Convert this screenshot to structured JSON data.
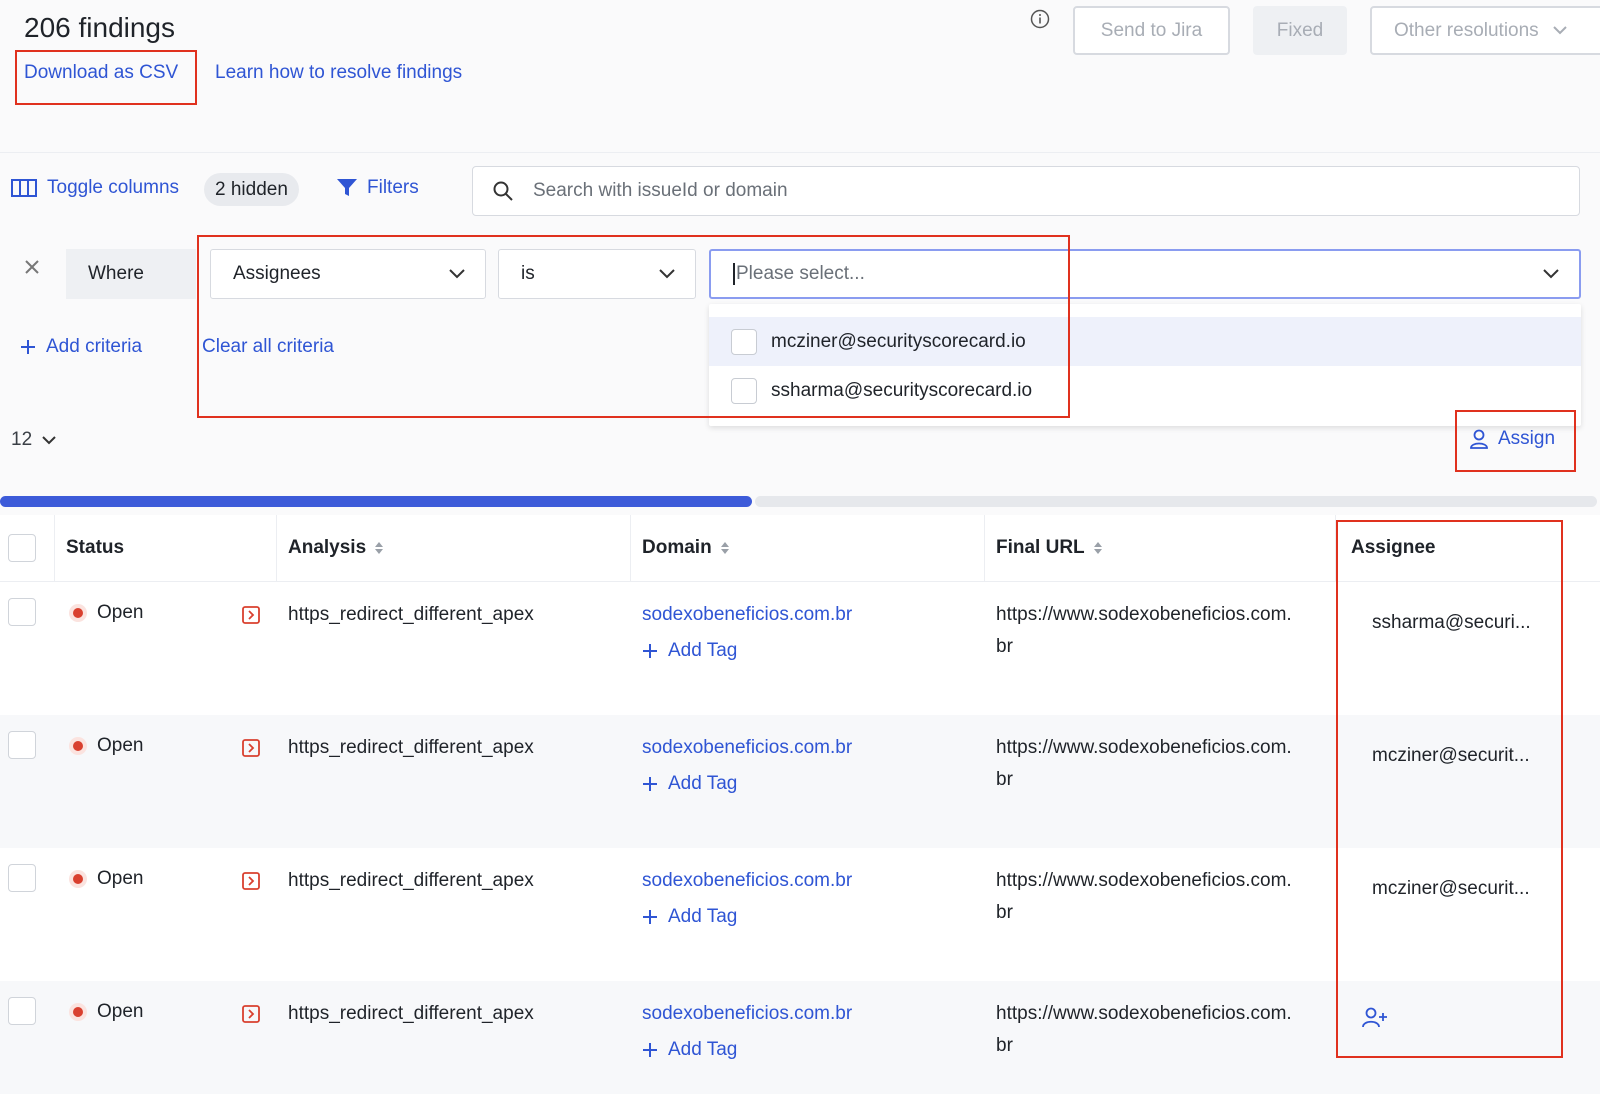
{
  "header": {
    "title": "206 findings",
    "download_csv": "Download as CSV",
    "learn_link": "Learn how to resolve findings",
    "send_to_jira": "Send to Jira",
    "fixed": "Fixed",
    "other_resolutions": "Other resolutions"
  },
  "toolbar": {
    "toggle_columns": "Toggle columns",
    "hidden_count": "2 hidden",
    "filters": "Filters",
    "search_placeholder": "Search with issueId or domain"
  },
  "filter": {
    "where": "Where",
    "field": "Assignees",
    "operator": "is",
    "value_placeholder": "Please select...",
    "add_criteria": "Add criteria",
    "clear_all": "Clear all criteria",
    "options": [
      "mcziner@securityscorecard.io",
      "ssharma@securityscorecard.io"
    ]
  },
  "pagination": {
    "per_page": "12"
  },
  "assign_label": "Assign",
  "scroll_progress": 0.47,
  "colors": {
    "accent": "#2f55d4",
    "danger": "#d9402f",
    "annotation": "#e0311e"
  },
  "table": {
    "headers": {
      "status": "Status",
      "analysis": "Analysis",
      "domain": "Domain",
      "final_url": "Final URL",
      "assignee": "Assignee"
    },
    "add_tag": "Add Tag",
    "rows": [
      {
        "status": "Open",
        "analysis": "https_redirect_different_apex",
        "domain": "sodexobeneficios.com.br",
        "url_line1": "https://www.sodexobeneficios.com.",
        "url_line2": "br",
        "assignee": "ssharma@securi..."
      },
      {
        "status": "Open",
        "analysis": "https_redirect_different_apex",
        "domain": "sodexobeneficios.com.br",
        "url_line1": "https://www.sodexobeneficios.com.",
        "url_line2": "br",
        "assignee": "mcziner@securit..."
      },
      {
        "status": "Open",
        "analysis": "https_redirect_different_apex",
        "domain": "sodexobeneficios.com.br",
        "url_line1": "https://www.sodexobeneficios.com.",
        "url_line2": "br",
        "assignee": "mcziner@securit..."
      },
      {
        "status": "Open",
        "analysis": "https_redirect_different_apex",
        "domain": "sodexobeneficios.com.br",
        "url_line1": "https://www.sodexobeneficios.com.",
        "url_line2": "br",
        "assignee": ""
      }
    ]
  }
}
